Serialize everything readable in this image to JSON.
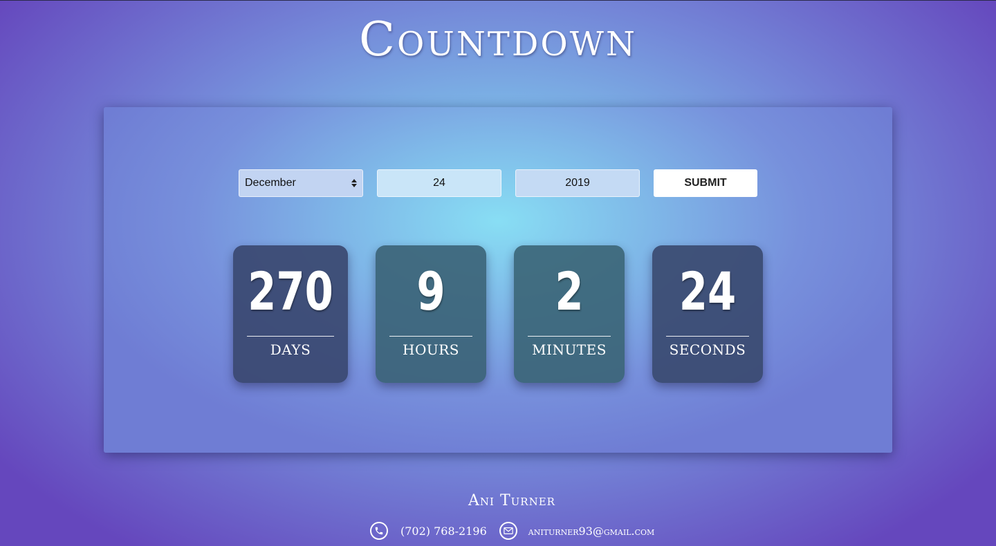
{
  "header": {
    "title": "Countdown"
  },
  "form": {
    "month_value": "December",
    "day_value": "24",
    "year_value": "2019",
    "submit_label": "SUBMIT"
  },
  "countdown": {
    "days": {
      "value": "270",
      "label": "DAYS"
    },
    "hours": {
      "value": "9",
      "label": "HOURS"
    },
    "minutes": {
      "value": "2",
      "label": "MINUTES"
    },
    "seconds": {
      "value": "24",
      "label": "SECONDS"
    }
  },
  "footer": {
    "name": "Ani Turner",
    "phone": "(702) 768-2196",
    "email": "aniturner93@gmail.com",
    "phone_icon": "phone-icon",
    "email_icon": "envelope-icon"
  },
  "colors": {
    "background_edge": "#6547bd",
    "background_center": "#86dcf2",
    "card": "#3a4870",
    "submit_bg": "#ffffff"
  }
}
